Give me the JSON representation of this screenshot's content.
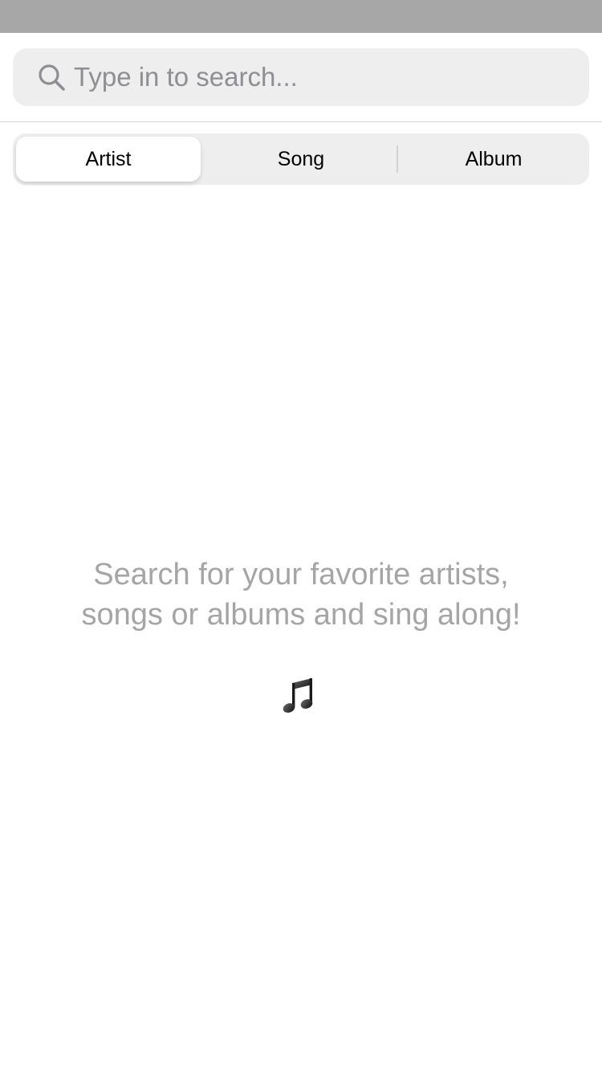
{
  "search": {
    "placeholder": "Type in to search...",
    "value": ""
  },
  "tabs": [
    {
      "label": "Artist",
      "selected": true
    },
    {
      "label": "Song",
      "selected": false
    },
    {
      "label": "Album",
      "selected": false
    }
  ],
  "empty_state": {
    "line1": "Search for your favorite artists,",
    "line2": "songs or albums and sing along!",
    "icon": "music-note-icon"
  },
  "colors": {
    "status_bar": "#a7a7a7",
    "search_background": "#eeeeee",
    "placeholder_text": "#8e8e93",
    "empty_state_text": "#a5a5a5"
  }
}
